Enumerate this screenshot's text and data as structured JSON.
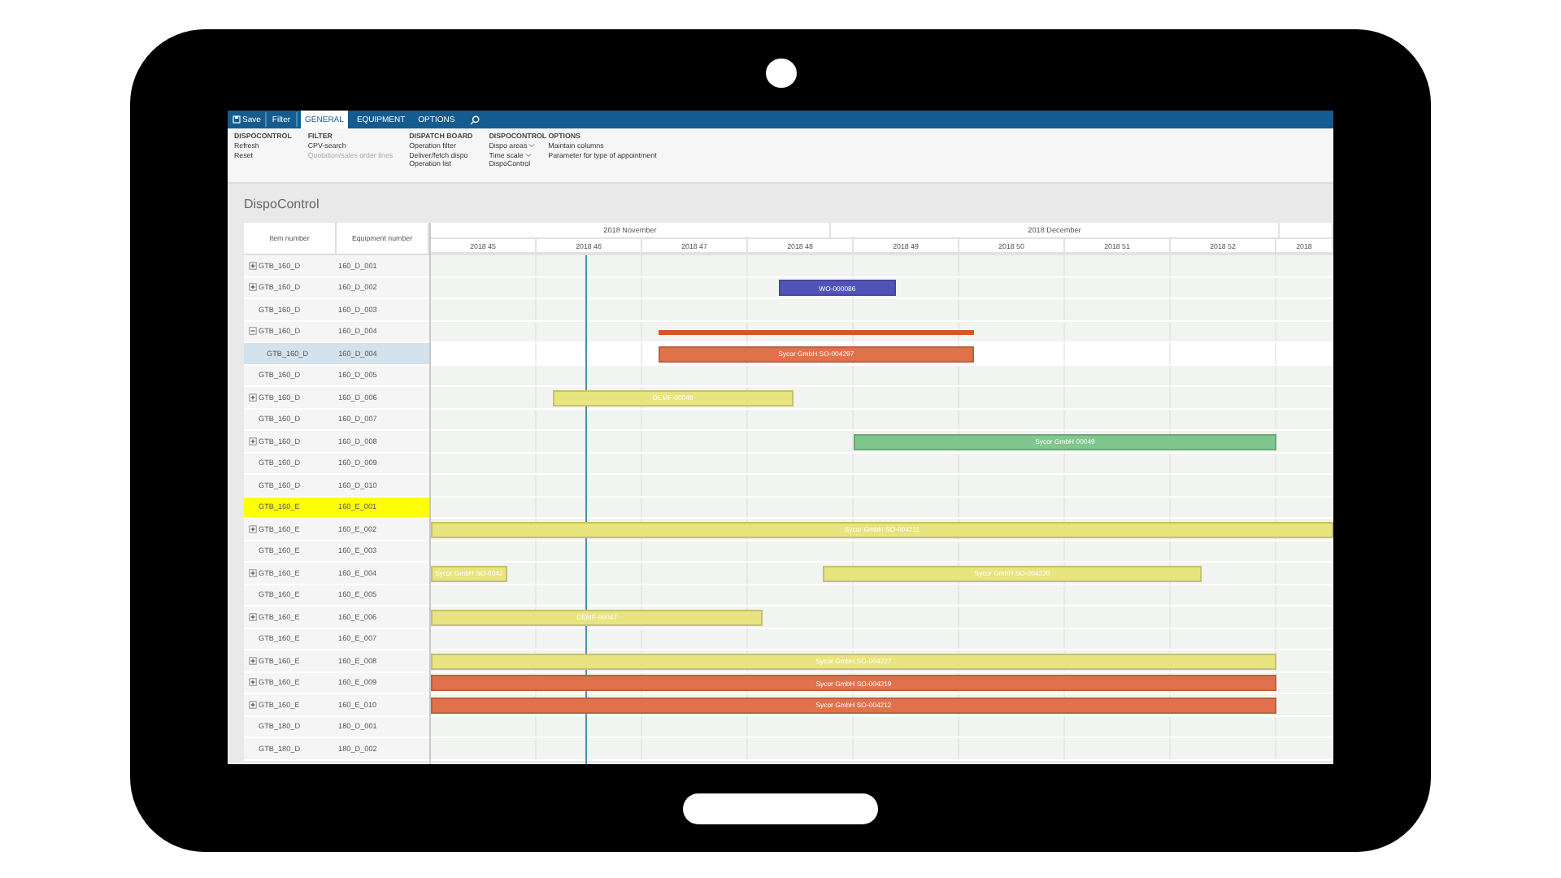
{
  "app_bar": {
    "actions": [
      {
        "label": "Save",
        "kind": "save"
      },
      {
        "label": "Filter",
        "kind": "plain"
      }
    ],
    "tabs": [
      {
        "label": "GENERAL",
        "selected": true
      },
      {
        "label": "EQUIPMENT",
        "selected": false
      },
      {
        "label": "OPTIONS",
        "selected": false
      }
    ]
  },
  "ribbon": {
    "groups": [
      {
        "title": "DISPOCONTROL",
        "columns": [
          [
            {
              "label": "Refresh",
              "kind": "button",
              "disabled": false
            },
            {
              "label": "Reset",
              "kind": "button",
              "disabled": false
            }
          ]
        ]
      },
      {
        "title": "FILTER",
        "columns": [
          [
            {
              "label": "CPV-search",
              "kind": "button",
              "disabled": false
            },
            {
              "label": "Quotation/sales order lines",
              "kind": "button",
              "disabled": true
            }
          ]
        ]
      },
      {
        "title": "DISPATCH BOARD",
        "columns": [
          [
            {
              "label": "Operation filter",
              "kind": "button",
              "disabled": false
            },
            {
              "label": "Deliver/fetch dispo",
              "kind": "button",
              "disabled": false
            },
            {
              "label": "Operation list",
              "kind": "button",
              "disabled": false
            }
          ]
        ]
      },
      {
        "title": "DISPOCONTROL OPTIONS",
        "columns": [
          [
            {
              "label": "Dispo areas",
              "kind": "dropdown",
              "disabled": false
            },
            {
              "label": "Time scale",
              "kind": "dropdown",
              "disabled": false
            },
            {
              "label": "DispoControl",
              "kind": "button",
              "disabled": false
            }
          ],
          [
            {
              "label": "Maintain columns",
              "kind": "button",
              "disabled": false
            },
            {
              "label": "Parameter for type of appointment",
              "kind": "button",
              "disabled": false
            }
          ]
        ]
      }
    ]
  },
  "page_title": "DispoControl",
  "grid": {
    "columns": [
      "Item number",
      "Equipment number"
    ],
    "months": [
      "2018 November",
      "2018 December"
    ],
    "weeks": [
      "2018 45",
      "2018 46",
      "2018 47",
      "2018 48",
      "2018 49",
      "2018 50",
      "2018 51",
      "2018 52",
      "2018"
    ],
    "rows": [
      {
        "item": "GTB_160_D",
        "equipment": "160_D_001",
        "expanded": false,
        "selected": false,
        "highlighted": false,
        "bars": []
      },
      {
        "item": "GTB_160_D",
        "equipment": "160_D_002",
        "expanded": false,
        "selected": false,
        "highlighted": false,
        "bars": [
          {
            "label": "WO-000086",
            "kind": "bar",
            "color": "#5253b9"
          }
        ]
      },
      {
        "item": "GTB_160_D",
        "equipment": "160_D_003",
        "selected": false,
        "highlighted": false,
        "bars": []
      },
      {
        "item": "GTB_160_D",
        "equipment": "160_D_004",
        "expanded": true,
        "selected": false,
        "highlighted": false,
        "bars": [
          {
            "kind": "line",
            "color": "#d9522b"
          }
        ],
        "children": [
          {
            "item": "GTB_160_D",
            "equipment": "160_D_004",
            "selected": true,
            "highlighted": false,
            "bars": [
              {
                "label": "Sycor GmbH SO-004297",
                "kind": "bar",
                "color": "#e0714b"
              }
            ]
          }
        ]
      },
      {
        "item": "GTB_160_D",
        "equipment": "160_D_005",
        "selected": false,
        "highlighted": false,
        "bars": []
      },
      {
        "item": "GTB_160_D",
        "equipment": "160_D_006",
        "expanded": false,
        "selected": false,
        "highlighted": false,
        "bars": [
          {
            "label": "DEMF-00048",
            "kind": "bar",
            "color": "#e8e47f"
          }
        ]
      },
      {
        "item": "GTB_160_D",
        "equipment": "160_D_007",
        "selected": false,
        "highlighted": false,
        "bars": []
      },
      {
        "item": "GTB_160_D",
        "equipment": "160_D_008",
        "expanded": false,
        "selected": false,
        "highlighted": false,
        "bars": [
          {
            "label": "Sycor GmbH 00049",
            "kind": "bar",
            "color": "#7fc78e"
          }
        ]
      },
      {
        "item": "GTB_160_D",
        "equipment": "160_D_009",
        "selected": false,
        "highlighted": false,
        "bars": []
      },
      {
        "item": "GTB_160_D",
        "equipment": "160_D_010",
        "selected": false,
        "highlighted": false,
        "bars": []
      },
      {
        "item": "GTB_160_E",
        "equipment": "160_E_001",
        "selected": false,
        "highlighted": true,
        "bars": []
      },
      {
        "item": "GTB_160_E",
        "equipment": "160_E_002",
        "expanded": false,
        "selected": false,
        "highlighted": false,
        "bars": [
          {
            "label": "Sycor GmbH SO-004211",
            "kind": "bar",
            "color": "#e8e47f"
          }
        ]
      },
      {
        "item": "GTB_160_E",
        "equipment": "160_E_003",
        "selected": false,
        "highlighted": false,
        "bars": []
      },
      {
        "item": "GTB_160_E",
        "equipment": "160_E_004",
        "expanded": false,
        "selected": false,
        "highlighted": false,
        "bars": [
          {
            "label": "Sycor GmbH SO-0042",
            "kind": "bar",
            "color": "#e8e47f"
          },
          {
            "label": "Sycor GmbH SO-004220",
            "kind": "bar",
            "color": "#e8e47f"
          }
        ]
      },
      {
        "item": "GTB_160_E",
        "equipment": "160_E_005",
        "selected": false,
        "highlighted": false,
        "bars": []
      },
      {
        "item": "GTB_160_E",
        "equipment": "160_E_006",
        "expanded": false,
        "selected": false,
        "highlighted": false,
        "bars": [
          {
            "label": "DEMF-00047",
            "kind": "bar",
            "color": "#e8e47f"
          }
        ]
      },
      {
        "item": "GTB_160_E",
        "equipment": "160_E_007",
        "selected": false,
        "highlighted": false,
        "bars": []
      },
      {
        "item": "GTB_160_E",
        "equipment": "160_E_008",
        "expanded": false,
        "selected": false,
        "highlighted": false,
        "bars": [
          {
            "label": "Sycor GmbH SO-004227",
            "kind": "bar",
            "color": "#e8e47f"
          }
        ]
      },
      {
        "item": "GTB_160_E",
        "equipment": "160_E_009",
        "expanded": false,
        "selected": false,
        "highlighted": false,
        "bars": [
          {
            "label": "Sycor GmbH SO-004219",
            "kind": "bar",
            "color": "#e0714b"
          }
        ]
      },
      {
        "item": "GTB_160_E",
        "equipment": "160_E_010",
        "expanded": false,
        "selected": false,
        "highlighted": false,
        "bars": [
          {
            "label": "Sycor GmbH SO-004212",
            "kind": "bar",
            "color": "#e0714b"
          }
        ]
      },
      {
        "item": "GTB_180_D",
        "equipment": "180_D_001",
        "selected": false,
        "highlighted": false,
        "bars": []
      },
      {
        "item": "GTB_180_D",
        "equipment": "180_D_002",
        "selected": false,
        "highlighted": false,
        "bars": []
      }
    ]
  }
}
